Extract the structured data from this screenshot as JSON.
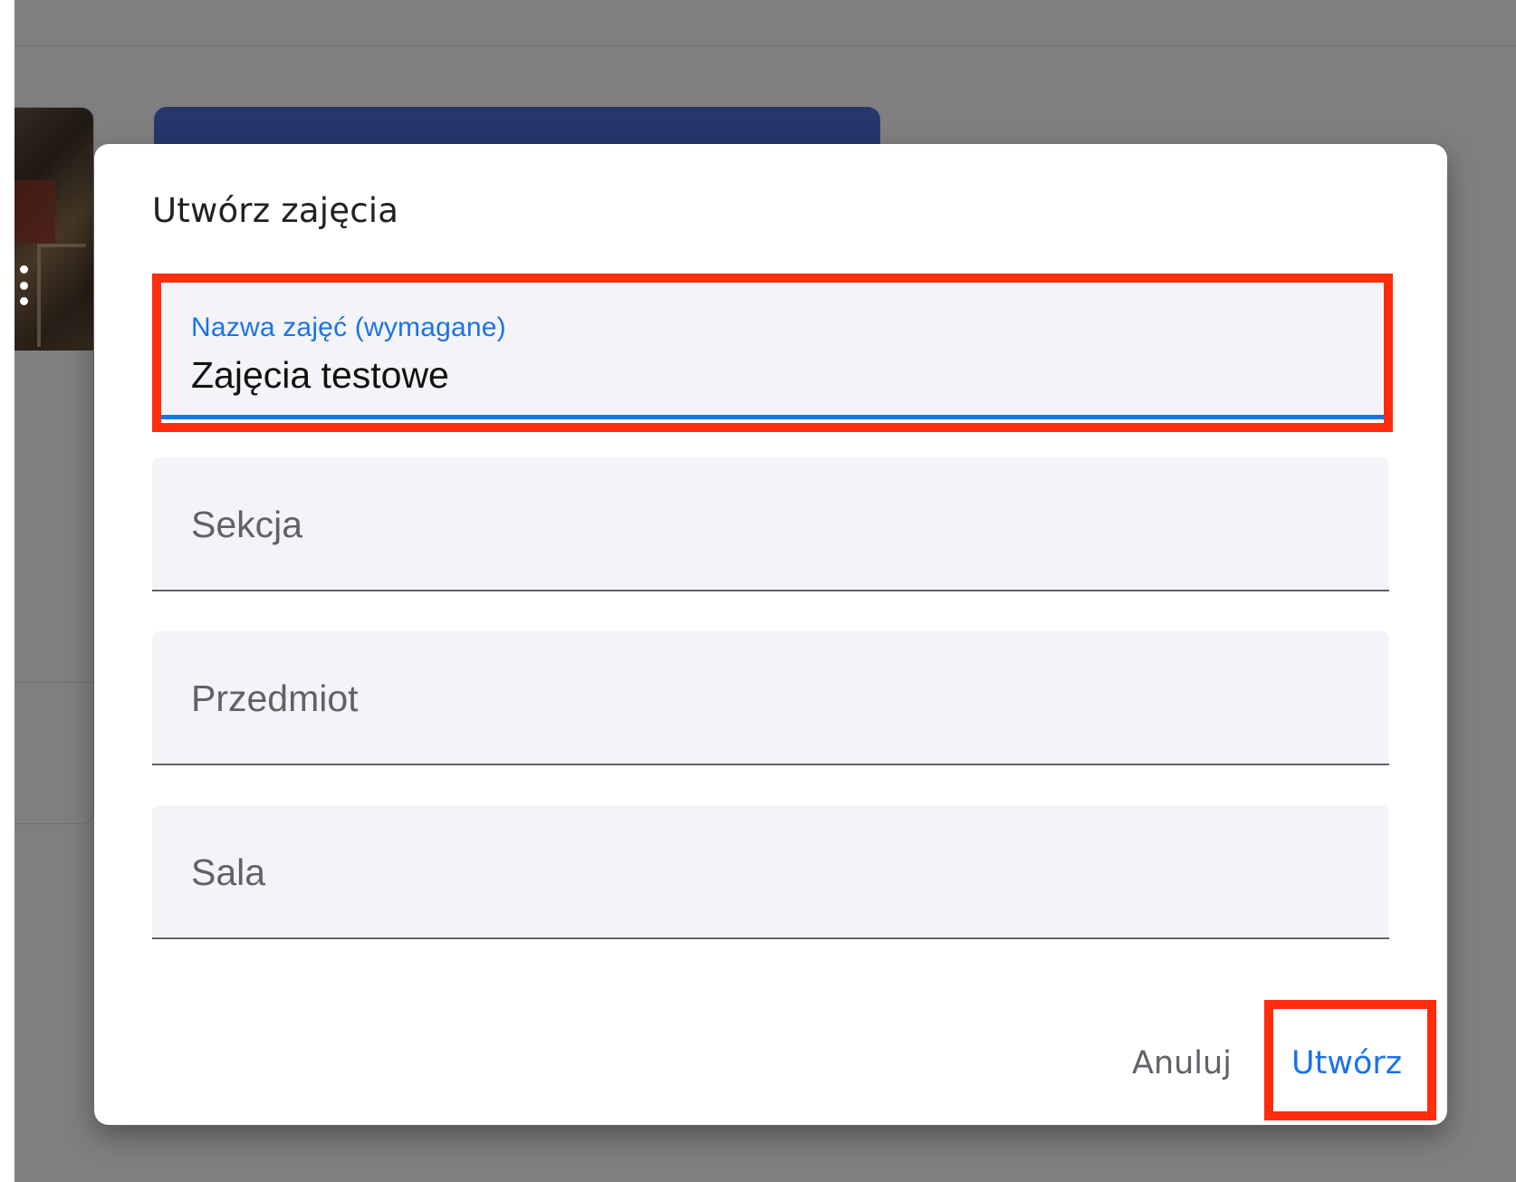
{
  "dialog": {
    "title": "Utwórz zajęcia",
    "fields": {
      "class_name": {
        "label": "Nazwa zajęć (wymagane)",
        "value": "Zajęcia testowe"
      },
      "section": {
        "placeholder": "Sekcja",
        "value": ""
      },
      "subject": {
        "placeholder": "Przedmiot",
        "value": ""
      },
      "room": {
        "placeholder": "Sala",
        "value": ""
      }
    },
    "actions": {
      "cancel_label": "Anuluj",
      "create_label": "Utwórz"
    }
  },
  "colors": {
    "accent": "#1a73e8",
    "highlight": "#ff2d0d",
    "field_background": "#f4f4f8",
    "scrim": "rgba(0,0,0,0.5)"
  },
  "background": {
    "icons": [
      "more-vert-icon",
      "folder-icon"
    ]
  }
}
